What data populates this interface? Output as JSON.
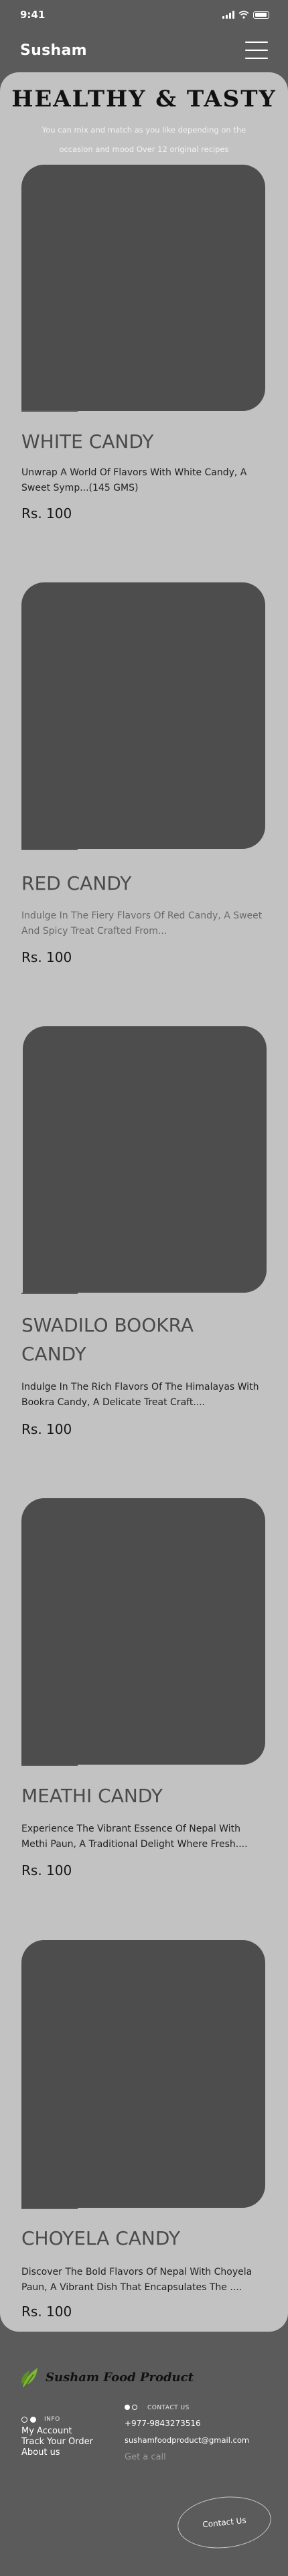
{
  "status_bar": {
    "time": "9:41"
  },
  "header": {
    "brand": "Susham"
  },
  "hero": {
    "title": "HEALTHY & TASTY",
    "subtitle": "You can mix and match as you like depending on the occasion and mood Over 12 original recipes"
  },
  "products": [
    {
      "name": "WHITE CANDY",
      "description": "Unwrap A World Of Flavors With White Candy, A Sweet Symp...(145 GMS)",
      "price": "Rs. 100"
    },
    {
      "name": "RED CANDY",
      "description": "Indulge In The Fiery Flavors Of Red Candy, A Sweet And Spicy Treat Crafted From...",
      "price": "Rs. 100"
    },
    {
      "name": "SWADILO BOOKRA CANDY",
      "description": "Indulge In The Rich Flavors Of The Himalayas With Bookra Candy, A Delicate Treat Craft....",
      "price": "Rs. 100"
    },
    {
      "name": "MEATHI CANDY",
      "description": "Experience The Vibrant Essence Of Nepal With Methi Paun, A Traditional Delight Where Fresh....",
      "price": "Rs. 100"
    },
    {
      "name": "CHOYELA CANDY",
      "description": "Discover The Bold Flavors Of Nepal With Choyela Paun, A Vibrant Dish That Encapsulates The ....",
      "price": "Rs. 100"
    }
  ],
  "footer": {
    "brand": "Susham Food Product",
    "info_title": "INFO",
    "links": [
      "My Account",
      "Track Your Order",
      "About us"
    ],
    "contact_title": "CONTACT US",
    "phone": "+977-9843273516",
    "email": "sushamfoodproduct@gmail.com",
    "call": "Get a call",
    "contact_button": "Contact Us"
  },
  "colors": {
    "page_background": "#5b5b5b",
    "card_background": "#c2c2c2",
    "image_placeholder": "#4d4d4d",
    "text_light": "#ffffff"
  },
  "icons": {
    "menu": "hamburger-menu-icon",
    "logo": "leaf-logo-icon"
  }
}
